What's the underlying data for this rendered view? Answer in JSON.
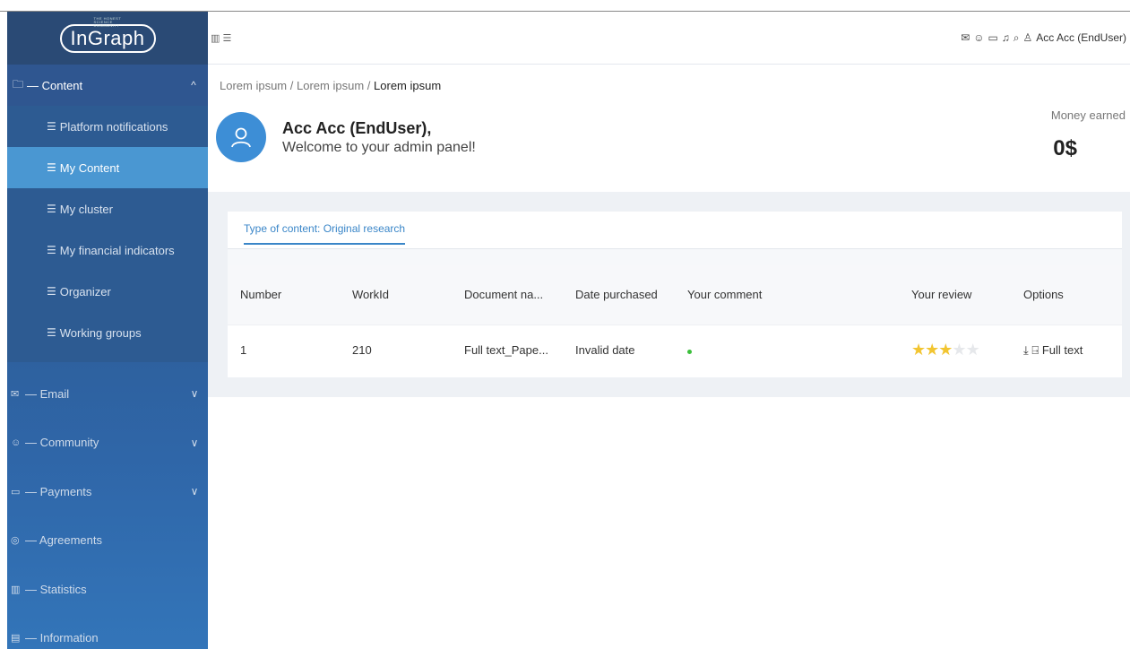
{
  "logo": {
    "text": "InGraph",
    "tagline": "THE HONEST SCIENCE COMMUNITY"
  },
  "sidebar": {
    "content_group": {
      "label": "— Content",
      "icon": "folder-icon",
      "chevron": "^"
    },
    "content_items": [
      {
        "label": "Platform notifications",
        "active": false
      },
      {
        "label": "My Content",
        "active": true
      },
      {
        "label": "My cluster",
        "active": false
      },
      {
        "label": "My financial indicators",
        "active": false
      },
      {
        "label": "Organizer",
        "active": false
      },
      {
        "label": "Working groups",
        "active": false
      }
    ],
    "nav": [
      {
        "label": "— Email",
        "icon": "mail-icon",
        "has_chevron": true
      },
      {
        "label": "— Community",
        "icon": "community-icon",
        "has_chevron": true
      },
      {
        "label": "— Payments",
        "icon": "payment-icon",
        "has_chevron": true
      },
      {
        "label": "— Agreements",
        "icon": "check-circle-icon",
        "has_chevron": false
      },
      {
        "label": "— Statistics",
        "icon": "chart-icon",
        "has_chevron": false
      },
      {
        "label": "— Information",
        "icon": "document-icon",
        "has_chevron": false
      }
    ]
  },
  "topbar": {
    "user_label": "Acc Acc (EndUser)"
  },
  "breadcrumb": {
    "item1": "Lorem ipsum",
    "item2": "Lorem ipsum",
    "current": "Lorem ipsum",
    "sep": "/"
  },
  "welcome": {
    "name": "Acc Acc (EndUser),",
    "message": "Welcome to your admin panel!"
  },
  "money": {
    "label": "Money earned",
    "value": "0$"
  },
  "tabs": {
    "active": "Type of content: Original research"
  },
  "table": {
    "headers": [
      "Number",
      "WorkId",
      "Document na...",
      "Date purchased",
      "Your comment",
      "Your review",
      "Options"
    ],
    "rows": [
      {
        "number": "1",
        "workid": "210",
        "document": "Full text_Pape...",
        "date": "Invalid date",
        "rating": 3,
        "rating_max": 5,
        "option": "Full text"
      }
    ]
  },
  "colors": {
    "sidebar": "#2f66a8",
    "active_item": "#4a97d2",
    "accent": "#3a86c8",
    "star": "#f2c531",
    "comment_dot": "#3bbf3b"
  }
}
